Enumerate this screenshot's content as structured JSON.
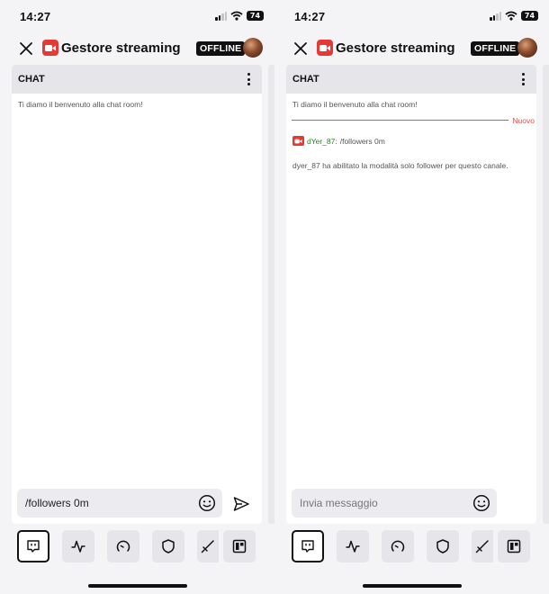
{
  "colors": {
    "accent": "#e53935",
    "new_line": "#e0524a",
    "username": "#2e7d32"
  },
  "screens": [
    {
      "status": {
        "time": "14:27",
        "battery": "74"
      },
      "header": {
        "close_icon": "close-icon",
        "title": "Gestore streaming",
        "status_badge": "OFFLINE"
      },
      "chat": {
        "title": "CHAT",
        "welcome": "Ti diamo il benvenuto alla chat room!"
      },
      "composer": {
        "value": "/followers 0m",
        "placeholder": "Invia messaggio"
      },
      "toolbar": [
        "chat-icon",
        "activity-icon",
        "gauge-icon",
        "shield-icon",
        "sword-icon",
        "quick-actions-icon"
      ]
    },
    {
      "status": {
        "time": "14:27",
        "battery": "74"
      },
      "header": {
        "close_icon": "close-icon",
        "title": "Gestore streaming",
        "status_badge": "OFFLINE"
      },
      "chat": {
        "title": "CHAT",
        "welcome": "Ti diamo il benvenuto alla chat room!",
        "new_label": "Nuovo",
        "message": {
          "username": "dYer_87",
          "separator": ":",
          "text": "/followers 0m"
        },
        "system": "dyer_87 ha abilitato la modalità solo follower per questo canale."
      },
      "composer": {
        "value": "",
        "placeholder": "Invia messaggio"
      },
      "toolbar": [
        "chat-icon",
        "activity-icon",
        "gauge-icon",
        "shield-icon",
        "sword-icon",
        "quick-actions-icon"
      ]
    }
  ]
}
